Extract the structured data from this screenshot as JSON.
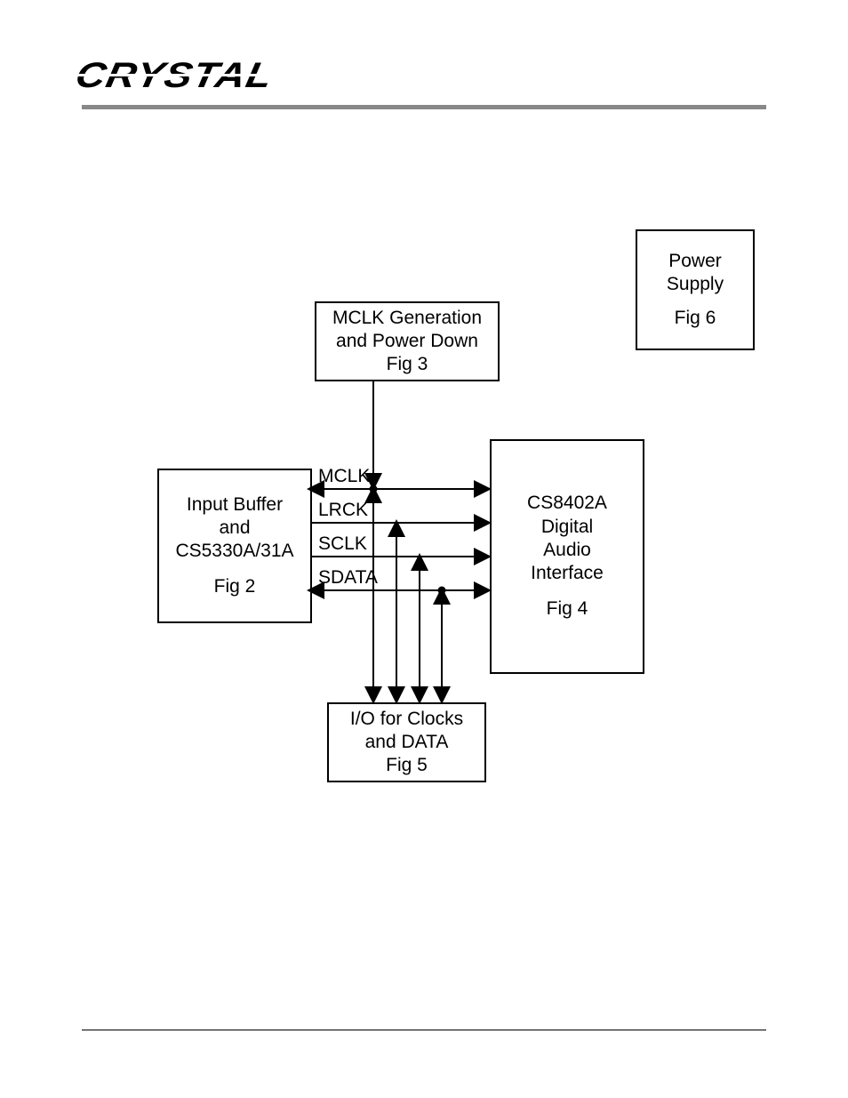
{
  "brand": "CRYSTAL",
  "blocks": {
    "mclk_gen": {
      "line1": "MCLK Generation",
      "line2": "and Power Down",
      "line3": "Fig 3"
    },
    "power": {
      "line1": "Power",
      "line2": "Supply",
      "line3": "Fig 6"
    },
    "input": {
      "line1": "Input Buffer",
      "line2": "and",
      "line3": "CS5330A/31A",
      "fig": "Fig 2"
    },
    "dai": {
      "line1": "CS8402A",
      "line2": "Digital",
      "line3": "Audio",
      "line4": "Interface",
      "fig": "Fig 4"
    },
    "io": {
      "line1": "I/O for Clocks",
      "line2": "and DATA",
      "line3": "Fig 5"
    }
  },
  "signals": {
    "mclk": "MCLK",
    "lrck": "LRCK",
    "sclk": "SCLK",
    "sdata": "SDATA"
  },
  "diagram": {
    "type": "block",
    "connections": [
      {
        "from": "mclk_gen",
        "to": "bus",
        "dir": "down"
      },
      {
        "signal": "MCLK",
        "from": "bus",
        "to": [
          "input",
          "dai"
        ],
        "dir": "bidir"
      },
      {
        "signal": "LRCK",
        "from": "input",
        "to": "dai",
        "dir": "right",
        "tap_to_io": true
      },
      {
        "signal": "SCLK",
        "from": "input",
        "to": "dai",
        "dir": "right",
        "tap_to_io": true
      },
      {
        "signal": "SDATA",
        "from": "input",
        "to": "dai",
        "dir": "bidir",
        "tap_to_io": true
      },
      {
        "signal": "MCLK",
        "from": "bus",
        "to": "io",
        "dir": "down"
      }
    ]
  }
}
